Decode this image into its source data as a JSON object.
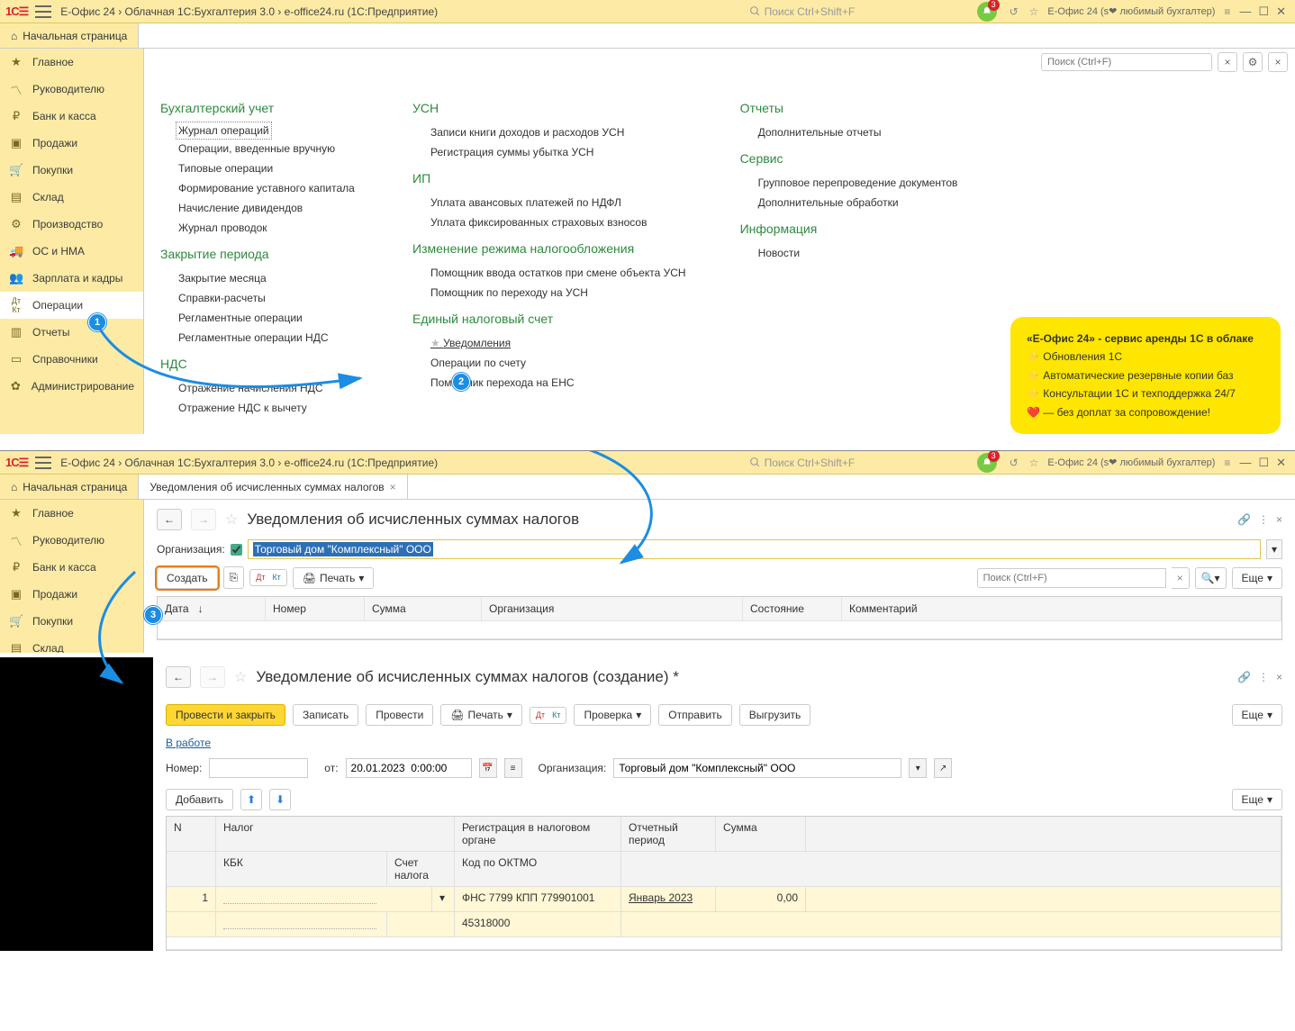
{
  "app": {
    "path": "Е-Офис 24 › Облачная 1С:Бухгалтерия 3.0 › e-office24.ru  (1С:Предприятие)",
    "search_ph": "Поиск Ctrl+Shift+F",
    "bell_count": "3",
    "header_note": "Е-Офис 24 (s❤ любимый бухгалтер)"
  },
  "tabs": {
    "home": "Начальная страница",
    "notif": "Уведомления об исчисленных суммах налогов"
  },
  "sidebar": {
    "items": [
      "Главное",
      "Руководителю",
      "Банк и касса",
      "Продажи",
      "Покупки",
      "Склад",
      "Производство",
      "ОС и НМА",
      "Зарплата и кадры",
      "Операции",
      "Отчеты",
      "Справочники",
      "Администрирование"
    ]
  },
  "content_search_ph": "Поиск (Ctrl+F)",
  "sections": {
    "col1": {
      "s1": {
        "title": "Бухгалтерский учет",
        "links": [
          "Журнал операций",
          "Операции, введенные вручную",
          "Типовые операции",
          "Формирование уставного капитала",
          "Начисление дивидендов",
          "Журнал проводок"
        ]
      },
      "s2": {
        "title": "Закрытие периода",
        "links": [
          "Закрытие месяца",
          "Справки-расчеты",
          "Регламентные операции",
          "Регламентные операции НДС"
        ]
      },
      "s3": {
        "title": "НДС",
        "links": [
          "Отражение начисления НДС",
          "Отражение НДС к вычету"
        ]
      }
    },
    "col2": {
      "s1": {
        "title": "УСН",
        "links": [
          "Записи книги доходов и расходов УСН",
          "Регистрация суммы убытка УСН"
        ]
      },
      "s2": {
        "title": "ИП",
        "links": [
          "Уплата авансовых платежей по НДФЛ",
          "Уплата фиксированных страховых взносов"
        ]
      },
      "s3": {
        "title": "Изменение режима налогообложения",
        "links": [
          "Помощник ввода остатков при смене объекта УСН",
          "Помощник по переходу на УСН"
        ]
      },
      "s4": {
        "title": "Единый налоговый счет",
        "links": [
          "Уведомления",
          "Операции по счету",
          "Помощник перехода на ЕНС"
        ]
      }
    },
    "col3": {
      "s1": {
        "title": "Отчеты",
        "links": [
          "Дополнительные отчеты"
        ]
      },
      "s2": {
        "title": "Сервис",
        "links": [
          "Групповое перепроведение документов",
          "Дополнительные обработки"
        ]
      },
      "s3": {
        "title": "Информация",
        "links": [
          "Новости"
        ]
      }
    }
  },
  "promo": {
    "line1": "«Е-Офис 24» - сервис аренды 1С в облаке",
    "b1": "Обновления 1С",
    "b2": "Автоматические резервные копии баз",
    "b3": "Консультации 1С и техподдержка 24/7",
    "b4": "— без доплат за сопровождение!"
  },
  "list": {
    "title": "Уведомления об исчисленных суммах налогов",
    "org_label": "Организация:",
    "org_value": "Торговый дом \"Комплексный\" ООО",
    "create": "Создать",
    "print": "Печать",
    "more": "Еще",
    "search_ph": "Поиск (Ctrl+F)",
    "cols": {
      "date": "Дата",
      "num": "Номер",
      "sum": "Сумма",
      "org": "Организация",
      "state": "Состояние",
      "comment": "Комментарий"
    }
  },
  "form": {
    "title": "Уведомление об исчисленных суммах налогов (создание) *",
    "post_close": "Провести и закрыть",
    "save": "Записать",
    "post": "Провести",
    "print": "Печать",
    "check": "Проверка",
    "send": "Отправить",
    "export": "Выгрузить",
    "more": "Еще",
    "status": "В работе",
    "num_label": "Номер:",
    "from_label": "от:",
    "date_value": "20.01.2023  0:00:00",
    "org_label": "Организация:",
    "org_value": "Торговый дом \"Комплексный\" ООО",
    "add": "Добавить",
    "grid": {
      "h_n": "N",
      "h_tax": "Налог",
      "h_reg": "Регистрация в налоговом органе",
      "h_period": "Отчетный период",
      "h_sum": "Сумма",
      "h_kbk": "КБК",
      "h_acct": "Счет налога",
      "h_oktmo": "Код по ОКТМО",
      "r_n": "1",
      "r_reg": "ФНС 7799 КПП 779901001",
      "r_period": "Январь 2023",
      "r_sum": "0,00",
      "r_oktmo": "45318000"
    }
  },
  "callouts": {
    "c1": "1",
    "c2": "2",
    "c3": "3"
  }
}
